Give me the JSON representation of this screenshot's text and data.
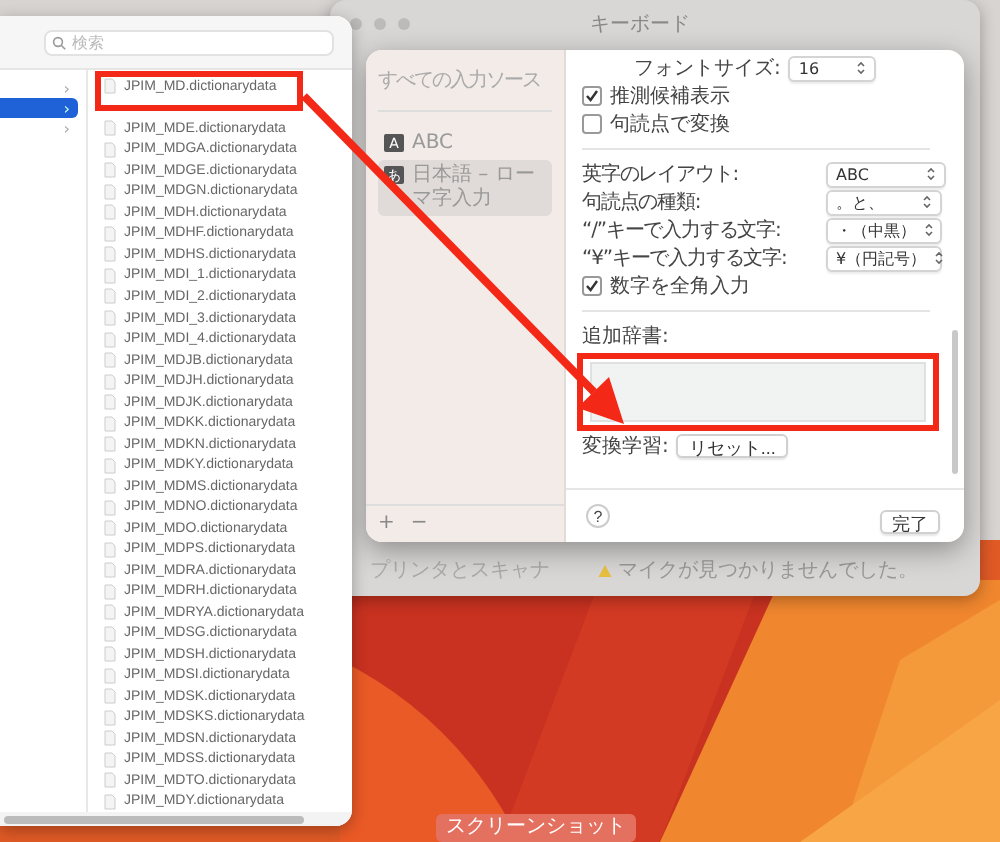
{
  "settings_window": {
    "title": "キーボード",
    "sidebar_item": "プリンタとスキャナ",
    "warning": "マイクが見つかりませんでした。"
  },
  "sheet": {
    "sidebar": {
      "heading": "すべての入力ソース",
      "items": [
        {
          "badge": "A",
          "label": "ABC",
          "selected": false
        },
        {
          "badge": "あ",
          "label": "日本語 – ローマ字入力",
          "selected": true
        }
      ],
      "add": "+",
      "remove": "−"
    },
    "rows": [
      {
        "kind": "stepper",
        "label": "フォントサイズ:",
        "value": "16"
      },
      {
        "kind": "checkbox",
        "label": "推測候補表示",
        "checked": true
      },
      {
        "kind": "checkbox",
        "label": "句読点で変換",
        "checked": false
      },
      {
        "kind": "divider"
      },
      {
        "kind": "popup",
        "label": "英字のレイアウト:",
        "value": "ABC"
      },
      {
        "kind": "popup",
        "label": "句読点の種類:",
        "value": "。と、"
      },
      {
        "kind": "popup",
        "label": "“/”キーで入力する文字:",
        "value": "・（中黒）"
      },
      {
        "kind": "popup",
        "label": "“¥”キーで入力する文字:",
        "value": "¥（円記号）"
      },
      {
        "kind": "checkbox",
        "label": "数字を全角入力",
        "checked": true
      },
      {
        "kind": "divider"
      },
      {
        "kind": "listbox",
        "label": "追加辞書:"
      },
      {
        "kind": "button",
        "label": "変換学習:",
        "value": "リセット..."
      }
    ],
    "help": "?",
    "done": "完了"
  },
  "finder": {
    "search": {
      "placeholder": "検索"
    },
    "sidebar": [
      {
        "chevron": "›",
        "selected": false
      },
      {
        "chevron": "›",
        "selected": true
      },
      {
        "chevron": "›",
        "selected": false
      }
    ],
    "files": [
      {
        "name": "JPIM_MD.dictionarydata"
      },
      {
        "name": "JPIM_MDE.dictionarydata"
      },
      {
        "name": "JPIM_MDGA.dictionarydata"
      },
      {
        "name": "JPIM_MDGE.dictionarydata"
      },
      {
        "name": "JPIM_MDGN.dictionarydata"
      },
      {
        "name": "JPIM_MDH.dictionarydata"
      },
      {
        "name": "JPIM_MDHF.dictionarydata"
      },
      {
        "name": "JPIM_MDHS.dictionarydata"
      },
      {
        "name": "JPIM_MDI_1.dictionarydata"
      },
      {
        "name": "JPIM_MDI_2.dictionarydata"
      },
      {
        "name": "JPIM_MDI_3.dictionarydata"
      },
      {
        "name": "JPIM_MDI_4.dictionarydata"
      },
      {
        "name": "JPIM_MDJB.dictionarydata"
      },
      {
        "name": "JPIM_MDJH.dictionarydata"
      },
      {
        "name": "JPIM_MDJK.dictionarydata"
      },
      {
        "name": "JPIM_MDKK.dictionarydata"
      },
      {
        "name": "JPIM_MDKN.dictionarydata"
      },
      {
        "name": "JPIM_MDKY.dictionarydata"
      },
      {
        "name": "JPIM_MDMS.dictionarydata"
      },
      {
        "name": "JPIM_MDNO.dictionarydata"
      },
      {
        "name": "JPIM_MDO.dictionarydata"
      },
      {
        "name": "JPIM_MDPS.dictionarydata"
      },
      {
        "name": "JPIM_MDRA.dictionarydata"
      },
      {
        "name": "JPIM_MDRH.dictionarydata"
      },
      {
        "name": "JPIM_MDRYA.dictionarydata"
      },
      {
        "name": "JPIM_MDSG.dictionarydata"
      },
      {
        "name": "JPIM_MDSH.dictionarydata"
      },
      {
        "name": "JPIM_MDSI.dictionarydata"
      },
      {
        "name": "JPIM_MDSK.dictionarydata"
      },
      {
        "name": "JPIM_MDSKS.dictionarydata"
      },
      {
        "name": "JPIM_MDSN.dictionarydata"
      },
      {
        "name": "JPIM_MDSS.dictionarydata"
      },
      {
        "name": "JPIM_MDTO.dictionarydata"
      },
      {
        "name": "JPIM_MDY.dictionarydata"
      }
    ]
  },
  "desktop_label": "スクリーンショット"
}
